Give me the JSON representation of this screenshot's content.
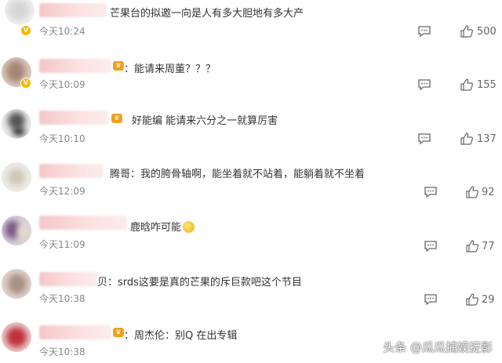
{
  "comments": [
    {
      "text": "芒果台的拟邀一向是人有多大胆地有多大产",
      "time": "今天10:24",
      "likes": "500"
    },
    {
      "text": "：能请来周董？？？",
      "time": "今天10:09",
      "likes": "155"
    },
    {
      "text": "好能编 能请来六分之一就算厉害",
      "time": "今天10:10",
      "likes": "137"
    },
    {
      "text": "腾哥：我的胯骨轴啊，能坐着就不站着，能躺着就不坐着",
      "time": "今天12:09",
      "likes": "92"
    },
    {
      "text": "鹿晗咋可能",
      "time": "今天11:09",
      "likes": "77"
    },
    {
      "text": "贝：srds这要是真的芒果的斥巨款吧这个节目",
      "time": "今天10:38",
      "likes": "29"
    },
    {
      "text": "：周杰伦：别Q 在出专辑",
      "time": "今天10:38",
      "likes": ""
    }
  ],
  "watermark": "头条 @瓜瓜捕娱捉影",
  "colors": {
    "accent_badge": "#f0a020",
    "verified": "#f5b800"
  }
}
